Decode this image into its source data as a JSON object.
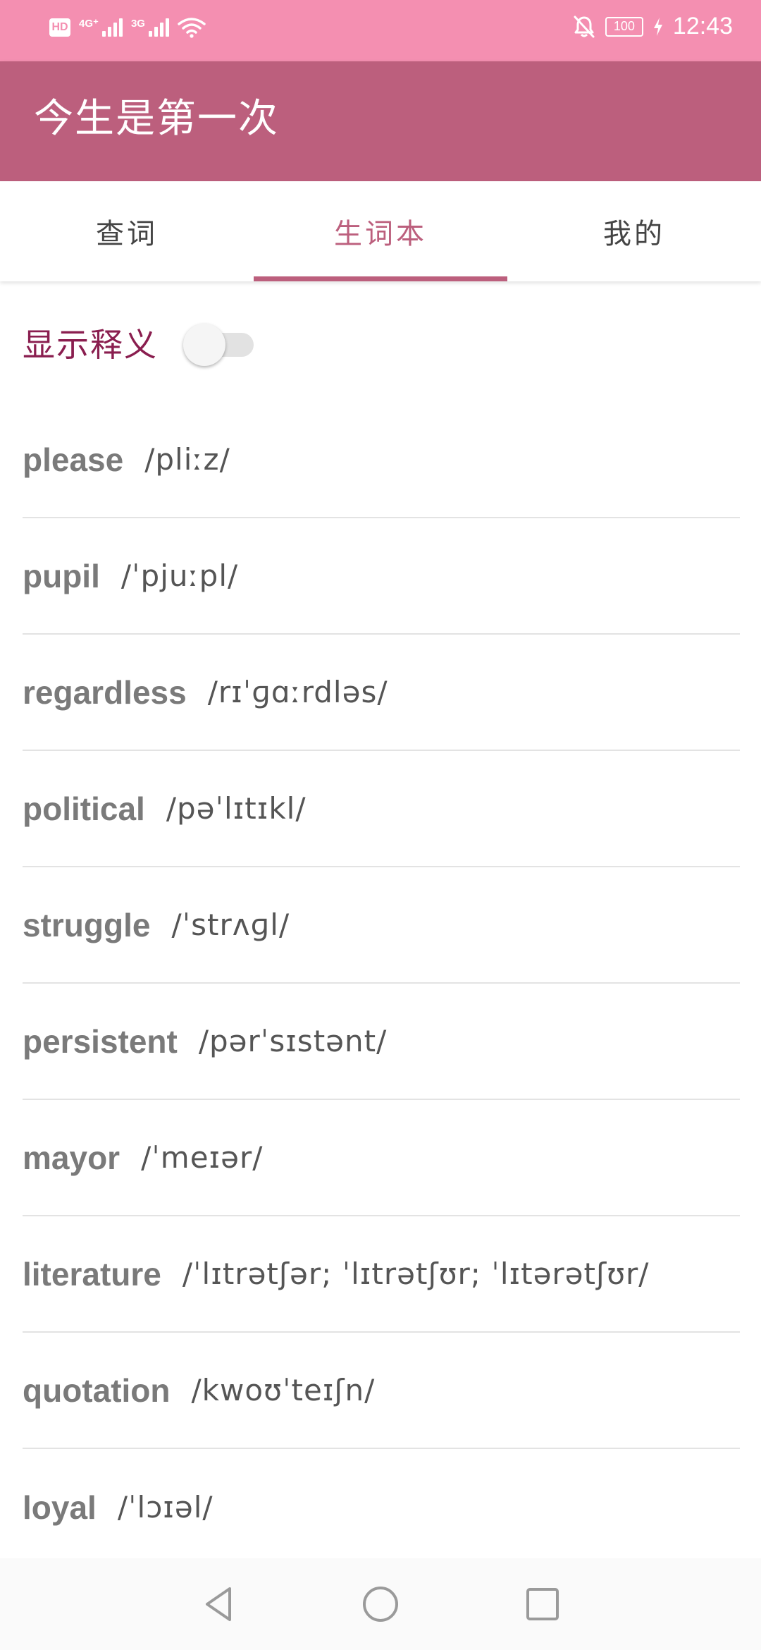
{
  "status_bar": {
    "hd_label": "HD",
    "net1": "4G⁺",
    "net2": "3G",
    "battery": "100",
    "time": "12:43",
    "color": "#f48fb1"
  },
  "app_bar": {
    "title": "今生是第一次",
    "color": "#bc5f7d"
  },
  "tabs": [
    {
      "label": "查词",
      "active": false
    },
    {
      "label": "生词本",
      "active": true
    },
    {
      "label": "我的",
      "active": false
    }
  ],
  "toggle": {
    "label": "显示释义",
    "on": false
  },
  "words": [
    {
      "word": "please",
      "phonetic": "/pliːz/"
    },
    {
      "word": "pupil",
      "phonetic": "/ˈpjuːpl/"
    },
    {
      "word": "regardless",
      "phonetic": "/rɪˈɡɑːrdləs/"
    },
    {
      "word": "political",
      "phonetic": "/pəˈlɪtɪkl/"
    },
    {
      "word": "struggle",
      "phonetic": "/ˈstrʌɡl/"
    },
    {
      "word": "persistent",
      "phonetic": "/pərˈsɪstənt/"
    },
    {
      "word": "mayor",
      "phonetic": "/ˈmeɪər/"
    },
    {
      "word": "literature",
      "phonetic": "/ˈlɪtrətʃər; ˈlɪtrətʃʊr; ˈlɪtərətʃʊr/"
    },
    {
      "word": "quotation",
      "phonetic": "/kwoʊˈteɪʃn/"
    },
    {
      "word": "loyal",
      "phonetic": "/ˈlɔɪəl/"
    }
  ],
  "nav_bar": {
    "icons": [
      "back-triangle-icon",
      "home-circle-icon",
      "recents-square-icon"
    ]
  }
}
